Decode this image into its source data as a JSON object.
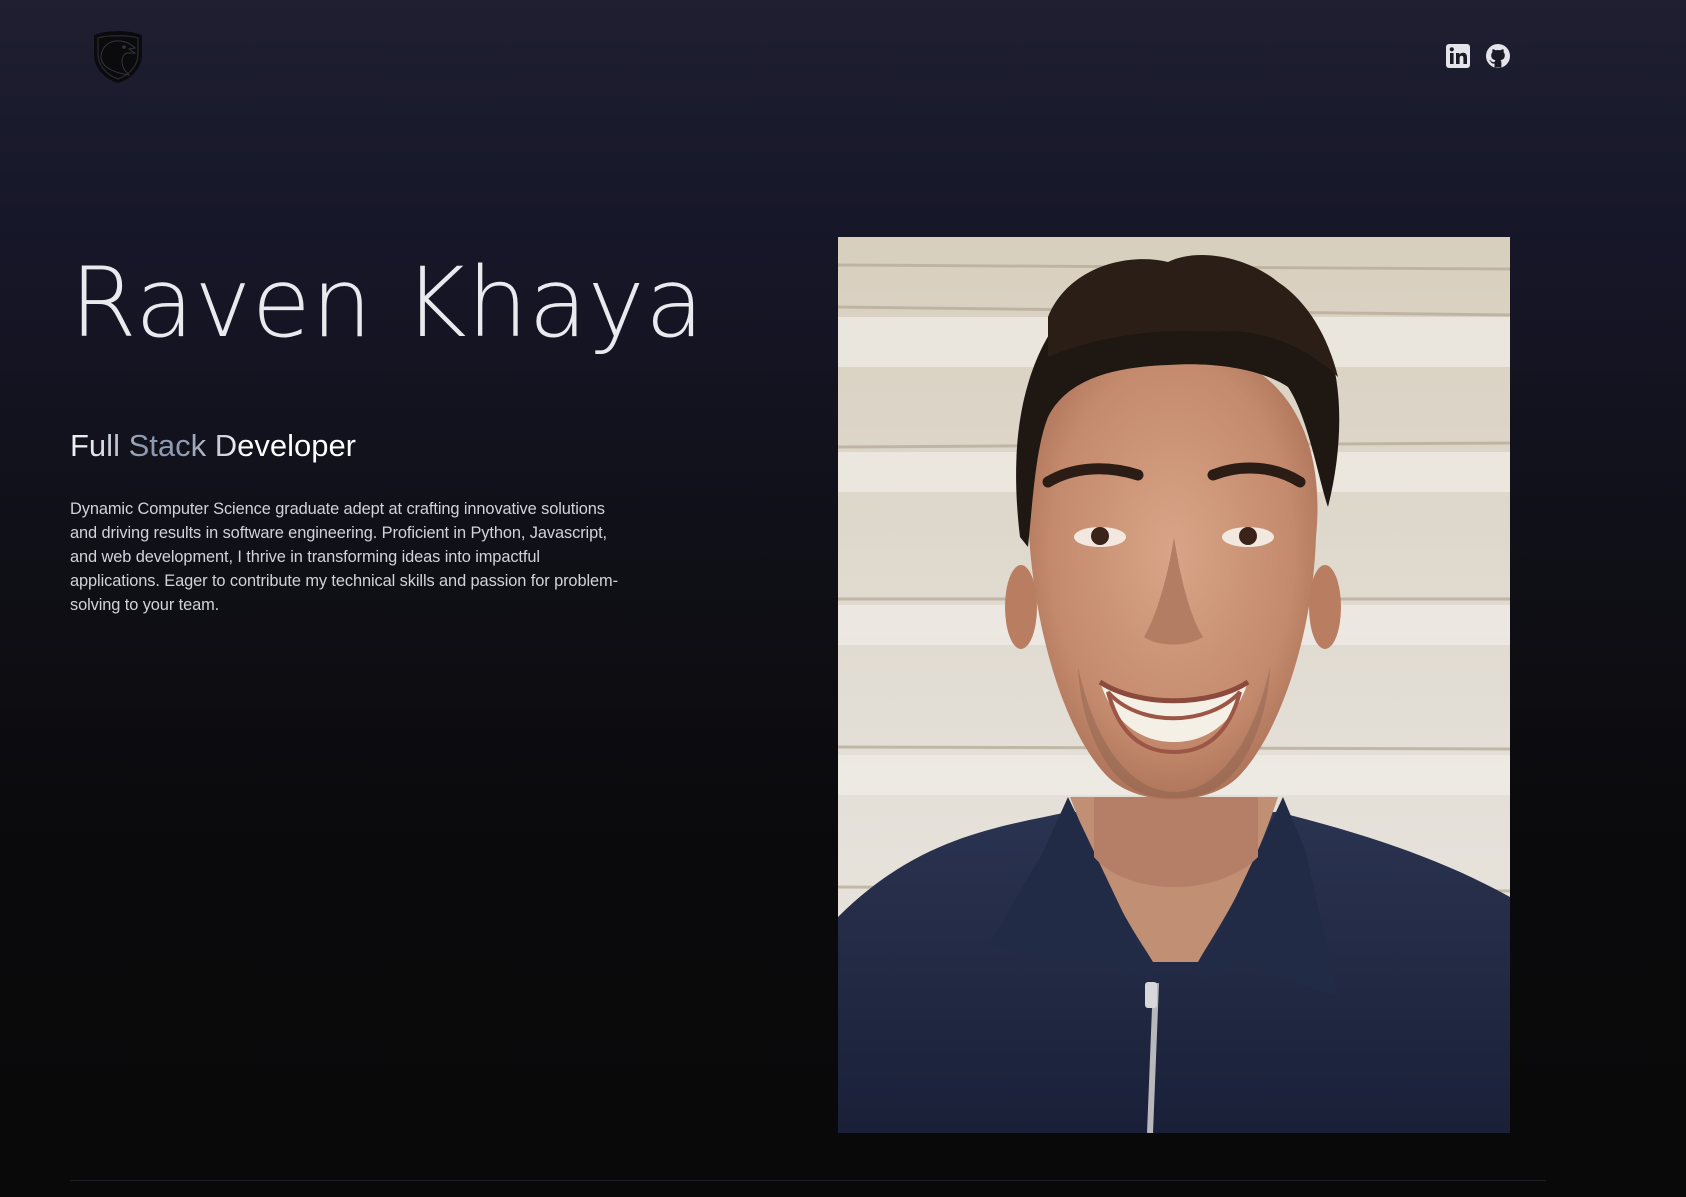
{
  "header": {
    "logo_icon": "raven-shield-icon",
    "social": [
      {
        "name": "LinkedIn",
        "icon": "linkedin-icon"
      },
      {
        "name": "GitHub",
        "icon": "github-icon"
      }
    ]
  },
  "hero": {
    "name": "Raven Khaya",
    "role": "Full Stack Developer",
    "bio": "Dynamic Computer Science graduate adept at crafting innovative solutions and driving results in software engineering. Proficient in Python, Javascript, and web development, I thrive in transforming ideas into impactful applications. Eager to contribute my technical skills and passion for problem-solving to your team.",
    "photo_icon": "profile-photo"
  },
  "colors": {
    "background_top": "#1f1f31",
    "background_bottom": "#09090a",
    "text": "#e9e9ee",
    "role_accent": "#8e98ad"
  }
}
